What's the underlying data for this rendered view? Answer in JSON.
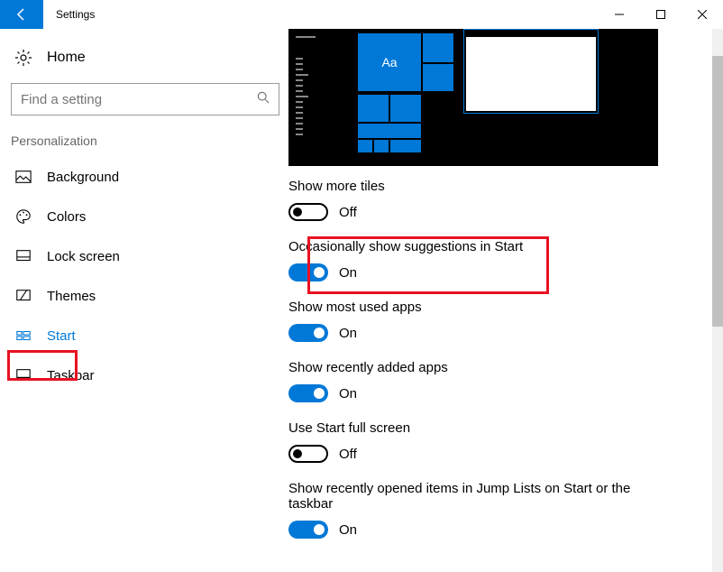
{
  "window": {
    "title": "Settings"
  },
  "sidebar": {
    "home": "Home",
    "search_placeholder": "Find a setting",
    "category": "Personalization",
    "items": [
      {
        "label": "Background"
      },
      {
        "label": "Colors"
      },
      {
        "label": "Lock screen"
      },
      {
        "label": "Themes"
      },
      {
        "label": "Start"
      },
      {
        "label": "Taskbar"
      }
    ]
  },
  "preview": {
    "tile_text": "Aa"
  },
  "settings": [
    {
      "label": "Show more tiles",
      "state": "Off",
      "on": false
    },
    {
      "label": "Occasionally show suggestions in Start",
      "state": "On",
      "on": true
    },
    {
      "label": "Show most used apps",
      "state": "On",
      "on": true
    },
    {
      "label": "Show recently added apps",
      "state": "On",
      "on": true
    },
    {
      "label": "Use Start full screen",
      "state": "Off",
      "on": false
    },
    {
      "label": "Show recently opened items in Jump Lists on Start or the taskbar",
      "state": "On",
      "on": true
    }
  ]
}
